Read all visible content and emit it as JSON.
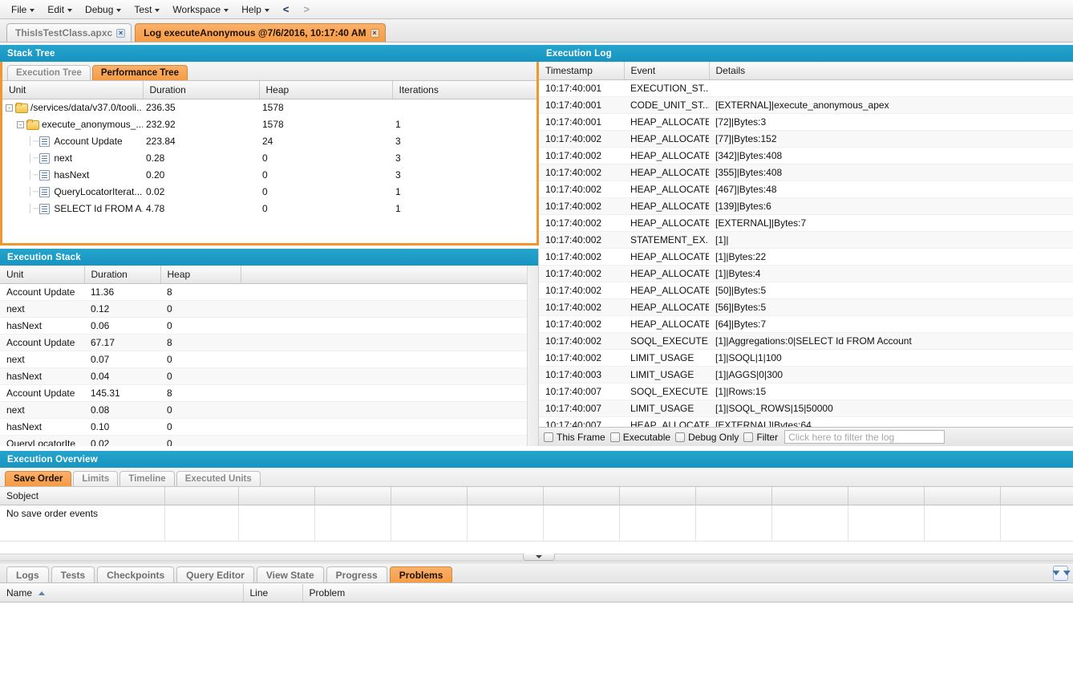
{
  "menubar": {
    "items": [
      {
        "label": "File",
        "has_caret": true
      },
      {
        "label": "Edit",
        "has_caret": true
      },
      {
        "label": "Debug",
        "has_caret": true
      },
      {
        "label": "Test",
        "has_caret": true
      },
      {
        "label": "Workspace",
        "has_caret": true
      },
      {
        "label": "Help",
        "has_caret": true
      }
    ],
    "nav_back": "<",
    "nav_forward": ">"
  },
  "file_tabs": [
    {
      "label": "ThisIsTestClass.apxc",
      "active": false,
      "close": "×"
    },
    {
      "label": "Log executeAnonymous @7/6/2016, 10:17:40 AM",
      "active": true,
      "close": "×"
    }
  ],
  "stack_tree": {
    "title": "Stack Tree",
    "tabs": [
      {
        "label": "Execution Tree",
        "active": false
      },
      {
        "label": "Performance Tree",
        "active": true
      }
    ],
    "columns": [
      "Unit",
      "Duration",
      "Heap",
      "Iterations"
    ],
    "rows": [
      {
        "unit": "/services/data/v37.0/tooli...",
        "duration": "236.35",
        "heap": "1578",
        "iterations": "",
        "depth": 0,
        "icon": "folder-icon",
        "toggle": "-"
      },
      {
        "unit": "execute_anonymous_...",
        "duration": "232.92",
        "heap": "1578",
        "iterations": "1",
        "depth": 1,
        "icon": "folder-icon",
        "toggle": "-"
      },
      {
        "unit": "Account Update",
        "duration": "223.84",
        "heap": "24",
        "iterations": "3",
        "depth": 2,
        "icon": "document-icon",
        "toggle": ""
      },
      {
        "unit": "next",
        "duration": "0.28",
        "heap": "0",
        "iterations": "3",
        "depth": 2,
        "icon": "document-icon",
        "toggle": ""
      },
      {
        "unit": "hasNext",
        "duration": "0.20",
        "heap": "0",
        "iterations": "3",
        "depth": 2,
        "icon": "document-icon",
        "toggle": ""
      },
      {
        "unit": "QueryLocatorIterat...",
        "duration": "0.02",
        "heap": "0",
        "iterations": "1",
        "depth": 2,
        "icon": "document-icon",
        "toggle": ""
      },
      {
        "unit": "SELECT Id FROM A...",
        "duration": "4.78",
        "heap": "0",
        "iterations": "1",
        "depth": 2,
        "icon": "document-icon",
        "toggle": ""
      }
    ]
  },
  "execution_stack": {
    "title": "Execution Stack",
    "columns": [
      "Unit",
      "Duration",
      "Heap",
      ""
    ],
    "rows": [
      {
        "unit": "Account Update",
        "duration": "11.36",
        "heap": "8"
      },
      {
        "unit": "next",
        "duration": "0.12",
        "heap": "0"
      },
      {
        "unit": "hasNext",
        "duration": "0.06",
        "heap": "0"
      },
      {
        "unit": "Account Update",
        "duration": "67.17",
        "heap": "8"
      },
      {
        "unit": "next",
        "duration": "0.07",
        "heap": "0"
      },
      {
        "unit": "hasNext",
        "duration": "0.04",
        "heap": "0"
      },
      {
        "unit": "Account Update",
        "duration": "145.31",
        "heap": "8"
      },
      {
        "unit": "next",
        "duration": "0.08",
        "heap": "0"
      },
      {
        "unit": "hasNext",
        "duration": "0.10",
        "heap": "0"
      },
      {
        "unit": "QueryLocatorIte",
        "duration": "0.02",
        "heap": "0"
      }
    ]
  },
  "execution_log": {
    "title": "Execution Log",
    "columns": [
      "Timestamp",
      "Event",
      "Details"
    ],
    "rows": [
      {
        "timestamp": "10:17:40:001",
        "event": "EXECUTION_ST...",
        "details": ""
      },
      {
        "timestamp": "10:17:40:001",
        "event": "CODE_UNIT_ST...",
        "details": "[EXTERNAL]|execute_anonymous_apex"
      },
      {
        "timestamp": "10:17:40:001",
        "event": "HEAP_ALLOCATE",
        "details": "[72]|Bytes:3"
      },
      {
        "timestamp": "10:17:40:002",
        "event": "HEAP_ALLOCATE",
        "details": "[77]|Bytes:152"
      },
      {
        "timestamp": "10:17:40:002",
        "event": "HEAP_ALLOCATE",
        "details": "[342]|Bytes:408"
      },
      {
        "timestamp": "10:17:40:002",
        "event": "HEAP_ALLOCATE",
        "details": "[355]|Bytes:408"
      },
      {
        "timestamp": "10:17:40:002",
        "event": "HEAP_ALLOCATE",
        "details": "[467]|Bytes:48"
      },
      {
        "timestamp": "10:17:40:002",
        "event": "HEAP_ALLOCATE",
        "details": "[139]|Bytes:6"
      },
      {
        "timestamp": "10:17:40:002",
        "event": "HEAP_ALLOCATE",
        "details": "[EXTERNAL]|Bytes:7"
      },
      {
        "timestamp": "10:17:40:002",
        "event": "STATEMENT_EX...",
        "details": "[1]|"
      },
      {
        "timestamp": "10:17:40:002",
        "event": "HEAP_ALLOCATE",
        "details": "[1]|Bytes:22"
      },
      {
        "timestamp": "10:17:40:002",
        "event": "HEAP_ALLOCATE",
        "details": "[1]|Bytes:4"
      },
      {
        "timestamp": "10:17:40:002",
        "event": "HEAP_ALLOCATE",
        "details": "[50]|Bytes:5"
      },
      {
        "timestamp": "10:17:40:002",
        "event": "HEAP_ALLOCATE",
        "details": "[56]|Bytes:5"
      },
      {
        "timestamp": "10:17:40:002",
        "event": "HEAP_ALLOCATE",
        "details": "[64]|Bytes:7"
      },
      {
        "timestamp": "10:17:40:002",
        "event": "SOQL_EXECUTE...",
        "details": "[1]|Aggregations:0|SELECT Id FROM Account"
      },
      {
        "timestamp": "10:17:40:002",
        "event": "LIMIT_USAGE",
        "details": "[1]|SOQL|1|100"
      },
      {
        "timestamp": "10:17:40:003",
        "event": "LIMIT_USAGE",
        "details": "[1]|AGGS|0|300"
      },
      {
        "timestamp": "10:17:40:007",
        "event": "SOQL_EXECUTE...",
        "details": "[1]|Rows:15"
      },
      {
        "timestamp": "10:17:40:007",
        "event": "LIMIT_USAGE",
        "details": "[1]|SOQL_ROWS|15|50000"
      },
      {
        "timestamp": "10:17:40:007",
        "event": "HEAP_ALLOCATE",
        "details": "[EXTERNAL]|Bytes:64"
      }
    ],
    "filters": [
      {
        "label": "This Frame",
        "checked": false
      },
      {
        "label": "Executable",
        "checked": false
      },
      {
        "label": "Debug Only",
        "checked": false
      },
      {
        "label": "Filter",
        "checked": false
      }
    ],
    "filter_placeholder": "Click here to filter the log",
    "filter_value": ""
  },
  "execution_overview": {
    "title": "Execution Overview",
    "tabs": [
      {
        "label": "Save Order",
        "active": true
      },
      {
        "label": "Limits",
        "active": false
      },
      {
        "label": "Timeline",
        "active": false
      },
      {
        "label": "Executed Units",
        "active": false
      }
    ],
    "columns": [
      "Sobject",
      "",
      "",
      "",
      "",
      "",
      "",
      "",
      "",
      "",
      "",
      "",
      ""
    ],
    "empty_message": "No save order events"
  },
  "bottom": {
    "tabs": [
      {
        "label": "Logs",
        "active": false
      },
      {
        "label": "Tests",
        "active": false
      },
      {
        "label": "Checkpoints",
        "active": false
      },
      {
        "label": "Query Editor",
        "active": false
      },
      {
        "label": "View State",
        "active": false
      },
      {
        "label": "Progress",
        "active": false
      },
      {
        "label": "Problems",
        "active": true
      }
    ],
    "expand_icon": "»",
    "problems": {
      "columns": [
        "Name",
        "Line",
        "Problem"
      ],
      "sorted_column": "Name",
      "sort_direction": "asc",
      "rows": []
    }
  },
  "theme": {
    "panel_header_bg": "#1d9cc8",
    "accent_orange": "#f59c45",
    "focus_border": "#f0962e"
  }
}
